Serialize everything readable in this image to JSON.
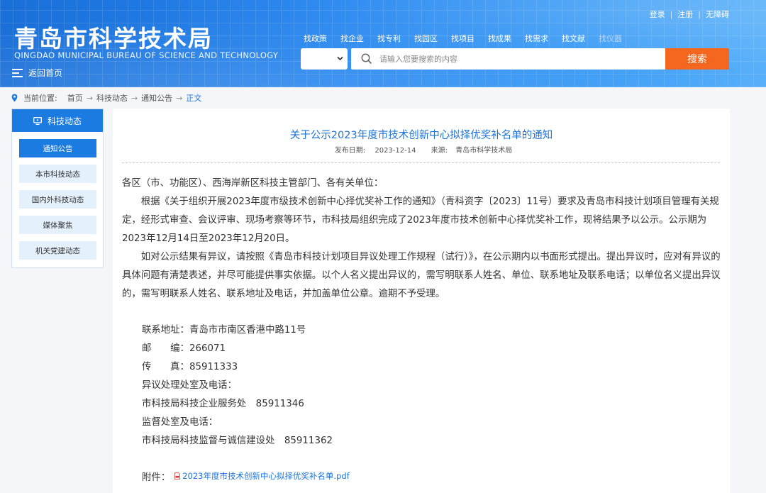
{
  "header": {
    "logo_cn": "青岛市科学技术局",
    "logo_en": "QINGDAO MUNICIPAL BUREAU OF SCIENCE AND TECHNOLOGY",
    "back_home": "返回首页",
    "top_links": [
      "登录",
      "注册",
      "无障碍"
    ],
    "nav": [
      "找政策",
      "找企业",
      "找专利",
      "找园区",
      "找项目",
      "找成果",
      "找需求",
      "找文献",
      "找仪器"
    ],
    "search_placeholder": "请输入您要搜索的内容",
    "search_button": "搜索",
    "colors": {
      "search_button": "#f5661f",
      "header_blue": "#2586f0"
    }
  },
  "breadcrumb": {
    "label": "当前位置:",
    "items": [
      "首页",
      "科技动态",
      "通知公告",
      "正文"
    ]
  },
  "sidebar": {
    "title": "科技动态",
    "items": [
      "通知公告",
      "本市科技动态",
      "国内外科技动态",
      "媒体聚焦",
      "机关党建动态"
    ]
  },
  "article": {
    "title": "关于公示2023年度市技术创新中心拟择优奖补名单的通知",
    "date_label": "发布日期:",
    "date": "2023-12-14",
    "source_label": "来源:",
    "source": "青岛市科学技术局",
    "salutation": "各区（市、功能区）、西海岸新区科技主管部门、各有关单位：",
    "para1": "根据《关于组织开展2023年度市级技术创新中心择优奖补工作的通知》（青科资字〔2023〕11号）要求及青岛市科技计划项目管理有关规定，经形式审查、会议评审、现场考察等环节，市科技局组织完成了2023年度市技术创新中心择优奖补工作，现将结果予以公示。公示期为2023年12月14日至2023年12月20日。",
    "para2": "如对公示结果有异议，请按照《青岛市科技计划项目异议处理工作规程（试行）》，在公示期内以书面形式提出。提出异议时，应对有异议的具体问题有清楚表述，并尽可能提供事实依据。以个人名义提出异议的，需写明联系人姓名、单位、联系地址及联系电话；以单位名义提出异议的，需写明联系人姓名、联系地址及电话，并加盖单位公章。逾期不予受理。",
    "contact": [
      "联系地址：青岛市市南区香港中路11号",
      "邮　　编：266071",
      "传　　真：85911333",
      "异议处理处室及电话：",
      "市科技局科技企业服务处　85911346",
      "监督处室及电话：",
      "市科技局科技监督与诚信建设处　85911362"
    ],
    "attachment_label": "附件：",
    "attachment": "2023年度市技术创新中心拟择优奖补名单.pdf"
  }
}
